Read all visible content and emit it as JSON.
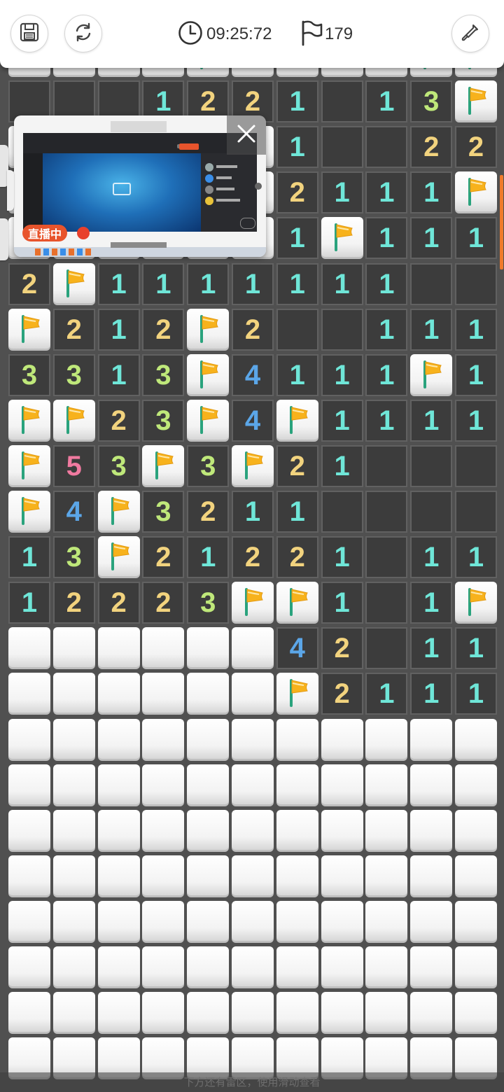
{
  "header": {
    "timer": "09:25:72",
    "flags": "179"
  },
  "stream_overlay": {
    "badge": "直播中"
  },
  "hint": "下方还有雷区，使用滑动查看",
  "colors": {
    "n1": "#6fe6d8",
    "n2": "#f2d37e",
    "n3": "#bfe87a",
    "n4": "#5ba6e8",
    "n5": "#f07aa0",
    "flag": "#f7b21c",
    "open_cell": "#3c3c3c",
    "accent": "#f07a2a"
  },
  "board": {
    "legend": "0=open empty, 1-8=number, F=flag, C=closed",
    "rows": [
      [
        "C",
        "C",
        "C",
        "C",
        "F",
        "C",
        "C",
        "C",
        "C",
        "F",
        "F"
      ],
      [
        "0",
        "0",
        "0",
        "1",
        "2",
        "2",
        "1",
        "0",
        "1",
        "3",
        "F"
      ],
      [
        "C",
        "C",
        "C",
        "C",
        "C",
        "C",
        "1",
        "0",
        "0",
        "2",
        "2"
      ],
      [
        "C",
        "C",
        "C",
        "C",
        "C",
        "C",
        "2",
        "1",
        "1",
        "1",
        "F"
      ],
      [
        "C",
        "C",
        "C",
        "C",
        "C",
        "C",
        "1",
        "F",
        "1",
        "1",
        "1"
      ],
      [
        "2",
        "F",
        "1",
        "1",
        "1",
        "1",
        "1",
        "1",
        "1",
        "0",
        "0"
      ],
      [
        "F",
        "2",
        "1",
        "2",
        "F",
        "2",
        "0",
        "0",
        "1",
        "1",
        "1"
      ],
      [
        "3",
        "3",
        "1",
        "3",
        "F",
        "4",
        "1",
        "1",
        "1",
        "F",
        "1"
      ],
      [
        "F",
        "F",
        "2",
        "3",
        "F",
        "4",
        "F",
        "1",
        "1",
        "1",
        "1"
      ],
      [
        "F",
        "5",
        "3",
        "F",
        "3",
        "F",
        "2",
        "1",
        "0",
        "0",
        "0"
      ],
      [
        "F",
        "4",
        "F",
        "3",
        "2",
        "1",
        "1",
        "0",
        "0",
        "0",
        "0"
      ],
      [
        "1",
        "3",
        "F",
        "2",
        "1",
        "2",
        "2",
        "1",
        "0",
        "1",
        "1"
      ],
      [
        "1",
        "2",
        "2",
        "2",
        "3",
        "F",
        "F",
        "1",
        "0",
        "1",
        "F"
      ],
      [
        "C",
        "C",
        "C",
        "C",
        "C",
        "C",
        "4",
        "2",
        "0",
        "1",
        "1"
      ],
      [
        "C",
        "C",
        "C",
        "C",
        "C",
        "C",
        "F",
        "2",
        "1",
        "1",
        "1"
      ],
      [
        "C",
        "C",
        "C",
        "C",
        "C",
        "C",
        "C",
        "C",
        "C",
        "C",
        "C"
      ],
      [
        "C",
        "C",
        "C",
        "C",
        "C",
        "C",
        "C",
        "C",
        "C",
        "C",
        "C"
      ],
      [
        "C",
        "C",
        "C",
        "C",
        "C",
        "C",
        "C",
        "C",
        "C",
        "C",
        "C"
      ],
      [
        "C",
        "C",
        "C",
        "C",
        "C",
        "C",
        "C",
        "C",
        "C",
        "C",
        "C"
      ],
      [
        "C",
        "C",
        "C",
        "C",
        "C",
        "C",
        "C",
        "C",
        "C",
        "C",
        "C"
      ],
      [
        "C",
        "C",
        "C",
        "C",
        "C",
        "C",
        "C",
        "C",
        "C",
        "C",
        "C"
      ],
      [
        "C",
        "C",
        "C",
        "C",
        "C",
        "C",
        "C",
        "C",
        "C",
        "C",
        "C"
      ],
      [
        "C",
        "C",
        "C",
        "C",
        "C",
        "C",
        "C",
        "C",
        "C",
        "C",
        "C"
      ]
    ]
  }
}
